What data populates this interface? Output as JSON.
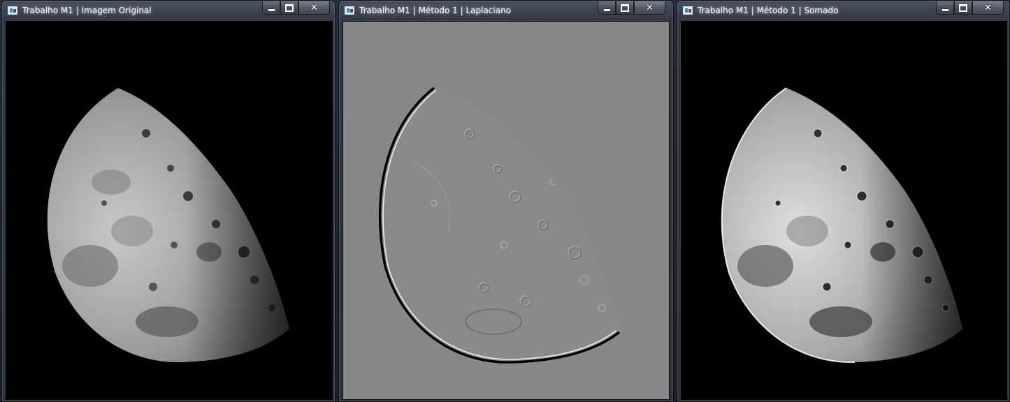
{
  "windows": [
    {
      "title": "Trabalho M1 | Imagem Original",
      "icon": "app-icon",
      "image_kind": "original-moon"
    },
    {
      "title": "Trabalho M1 | Método 1 | Laplaciano",
      "icon": "app-icon",
      "image_kind": "laplacian-moon"
    },
    {
      "title": "Trabalho M1 | Método 1 | Somado",
      "icon": "app-icon",
      "image_kind": "summed-moon"
    }
  ],
  "controls": {
    "minimize": "minimize",
    "maximize": "maximize",
    "close": "close"
  },
  "colors": {
    "laplacian_background": "#888888",
    "image_background": "#000000"
  }
}
